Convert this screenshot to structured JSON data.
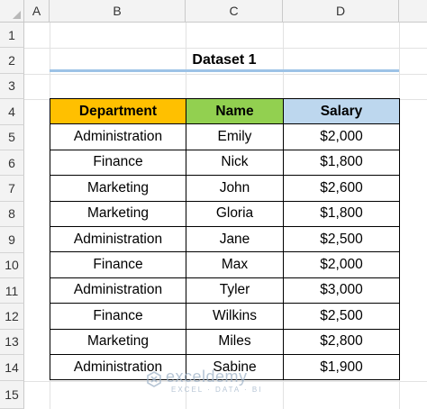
{
  "columns": [
    "A",
    "B",
    "C",
    "D"
  ],
  "rows": [
    "1",
    "2",
    "3",
    "4",
    "5",
    "6",
    "7",
    "8",
    "9",
    "10",
    "11",
    "12",
    "13",
    "14",
    "15"
  ],
  "title": "Dataset 1",
  "table": {
    "headers": [
      "Department",
      "Name",
      "Salary"
    ],
    "header_colors": [
      "#ffc000",
      "#92d050",
      "#bdd7ee"
    ],
    "rows": [
      [
        "Administration",
        "Emily",
        "$2,000"
      ],
      [
        "Finance",
        "Nick",
        "$1,800"
      ],
      [
        "Marketing",
        "John",
        "$2,600"
      ],
      [
        "Marketing",
        "Gloria",
        "$1,800"
      ],
      [
        "Administration",
        "Jane",
        "$2,500"
      ],
      [
        "Finance",
        "Max",
        "$2,000"
      ],
      [
        "Administration",
        "Tyler",
        "$3,000"
      ],
      [
        "Finance",
        "Wilkins",
        "$2,500"
      ],
      [
        "Marketing",
        "Miles",
        "$2,800"
      ],
      [
        "Administration",
        "Sabine",
        "$1,900"
      ]
    ]
  },
  "watermark": {
    "name": "exceldemy",
    "tagline": "EXCEL · DATA · BI",
    "icon": "exceldemy-logo-icon"
  }
}
